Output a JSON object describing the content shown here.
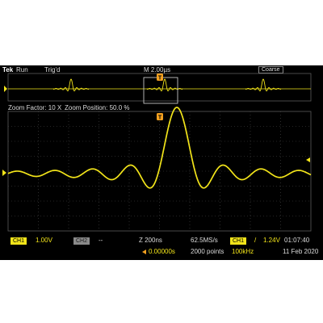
{
  "top_bar": {
    "brand": "Tek",
    "run_state": "Run",
    "trigger_state": "Trig'd",
    "timebase": "M 2.00µs",
    "knob_mode": "Coarse",
    "trigger_position_marker": "T"
  },
  "zoom_info": {
    "zoom_factor": "Zoom Factor: 10 X",
    "zoom_position": "Zoom Position: 50.0 %"
  },
  "bottom_status": {
    "ch1_label": "CH1",
    "ch1_scale": "1.00V",
    "ch2_label": "CH2",
    "ch2_scale": "--",
    "zoom_timebase": "Z 200ns",
    "sample_rate": "62.5MS/s",
    "trigger_source": "CH1",
    "trigger_slope": "/",
    "trigger_level": "1.24V",
    "time": "01:07:40",
    "horizontal_position": "0.00000s",
    "record_length": "2000 points",
    "frequency": "100kHz",
    "date": "11 Feb 2020"
  },
  "colors": {
    "background": "#000000",
    "trace": "#f2e41a",
    "grid": "#4a4a4a",
    "text": "#dcdcdc"
  }
}
